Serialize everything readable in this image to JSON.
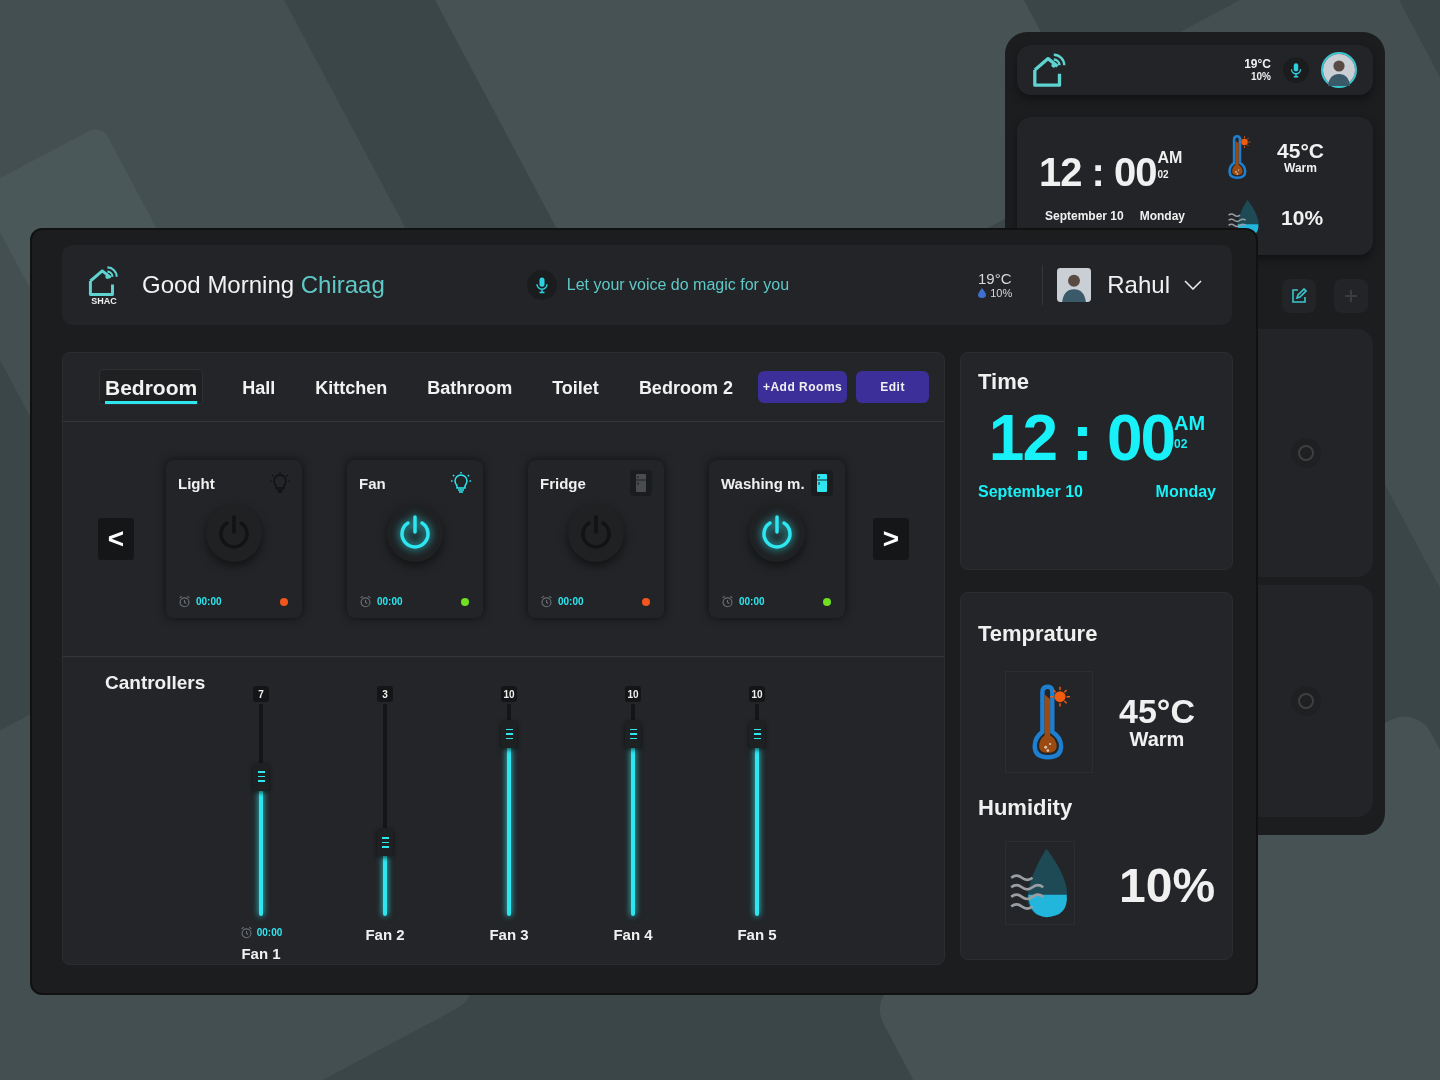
{
  "tablet": {
    "weather": {
      "temperature": "19°C",
      "humidity": "10%"
    },
    "clock": {
      "time": "12 : 00",
      "meridiem": "AM",
      "seconds": "02",
      "date": "September 10",
      "day": "Monday"
    },
    "temperature": {
      "value": "45°C",
      "label": "Warm"
    },
    "humidity": {
      "value": "10%"
    }
  },
  "header": {
    "logo": "SHAC",
    "greeting": "Good Morning",
    "user_name": "Chiraag",
    "voice_prompt": "Let your voice do magic for you",
    "weather": {
      "temperature": "19°C",
      "humidity": "10%"
    },
    "profile": {
      "name": "Rahul"
    }
  },
  "tabs": [
    {
      "label": "Bedroom",
      "selected": true
    },
    {
      "label": "Hall",
      "selected": false
    },
    {
      "label": "Kittchen",
      "selected": false
    },
    {
      "label": "Bathroom",
      "selected": false
    },
    {
      "label": "Toilet",
      "selected": false
    },
    {
      "label": "Bedroom 2",
      "selected": false
    }
  ],
  "actions": [
    "+Add Rooms",
    "Edit"
  ],
  "pager": {
    "previous": "<",
    "next": ">"
  },
  "devices": [
    {
      "name": "Light",
      "kind": "bulb",
      "on": false,
      "timer": "00:00"
    },
    {
      "name": "Fan",
      "kind": "bulb",
      "on": true,
      "timer": "00:00"
    },
    {
      "name": "Fridge",
      "kind": "fridge",
      "on": false,
      "timer": "00:00"
    },
    {
      "name": "Washing m.",
      "kind": "fridge",
      "on": true,
      "timer": "00:00"
    }
  ],
  "controllers": {
    "title": "Cantrollers",
    "items": [
      {
        "name": "Fan 1",
        "value": "7",
        "level": 0.62,
        "timer": "00:00"
      },
      {
        "name": "Fan 2",
        "value": "3",
        "level": 0.31
      },
      {
        "name": "Fan 3",
        "value": "10",
        "level": 0.82
      },
      {
        "name": "Fan 4",
        "value": "10",
        "level": 0.82
      },
      {
        "name": "Fan 5",
        "value": "10",
        "level": 0.82
      }
    ]
  },
  "time": {
    "title": "Time",
    "time": "12 : 00",
    "meridiem": "AM",
    "seconds": "02",
    "date": "September 10",
    "day": "Monday"
  },
  "climate": {
    "temperature_title": "Temprature",
    "temperature": "45°C",
    "temperature_label": "Warm",
    "humidity_title": "Humidity",
    "humidity": "10%"
  }
}
